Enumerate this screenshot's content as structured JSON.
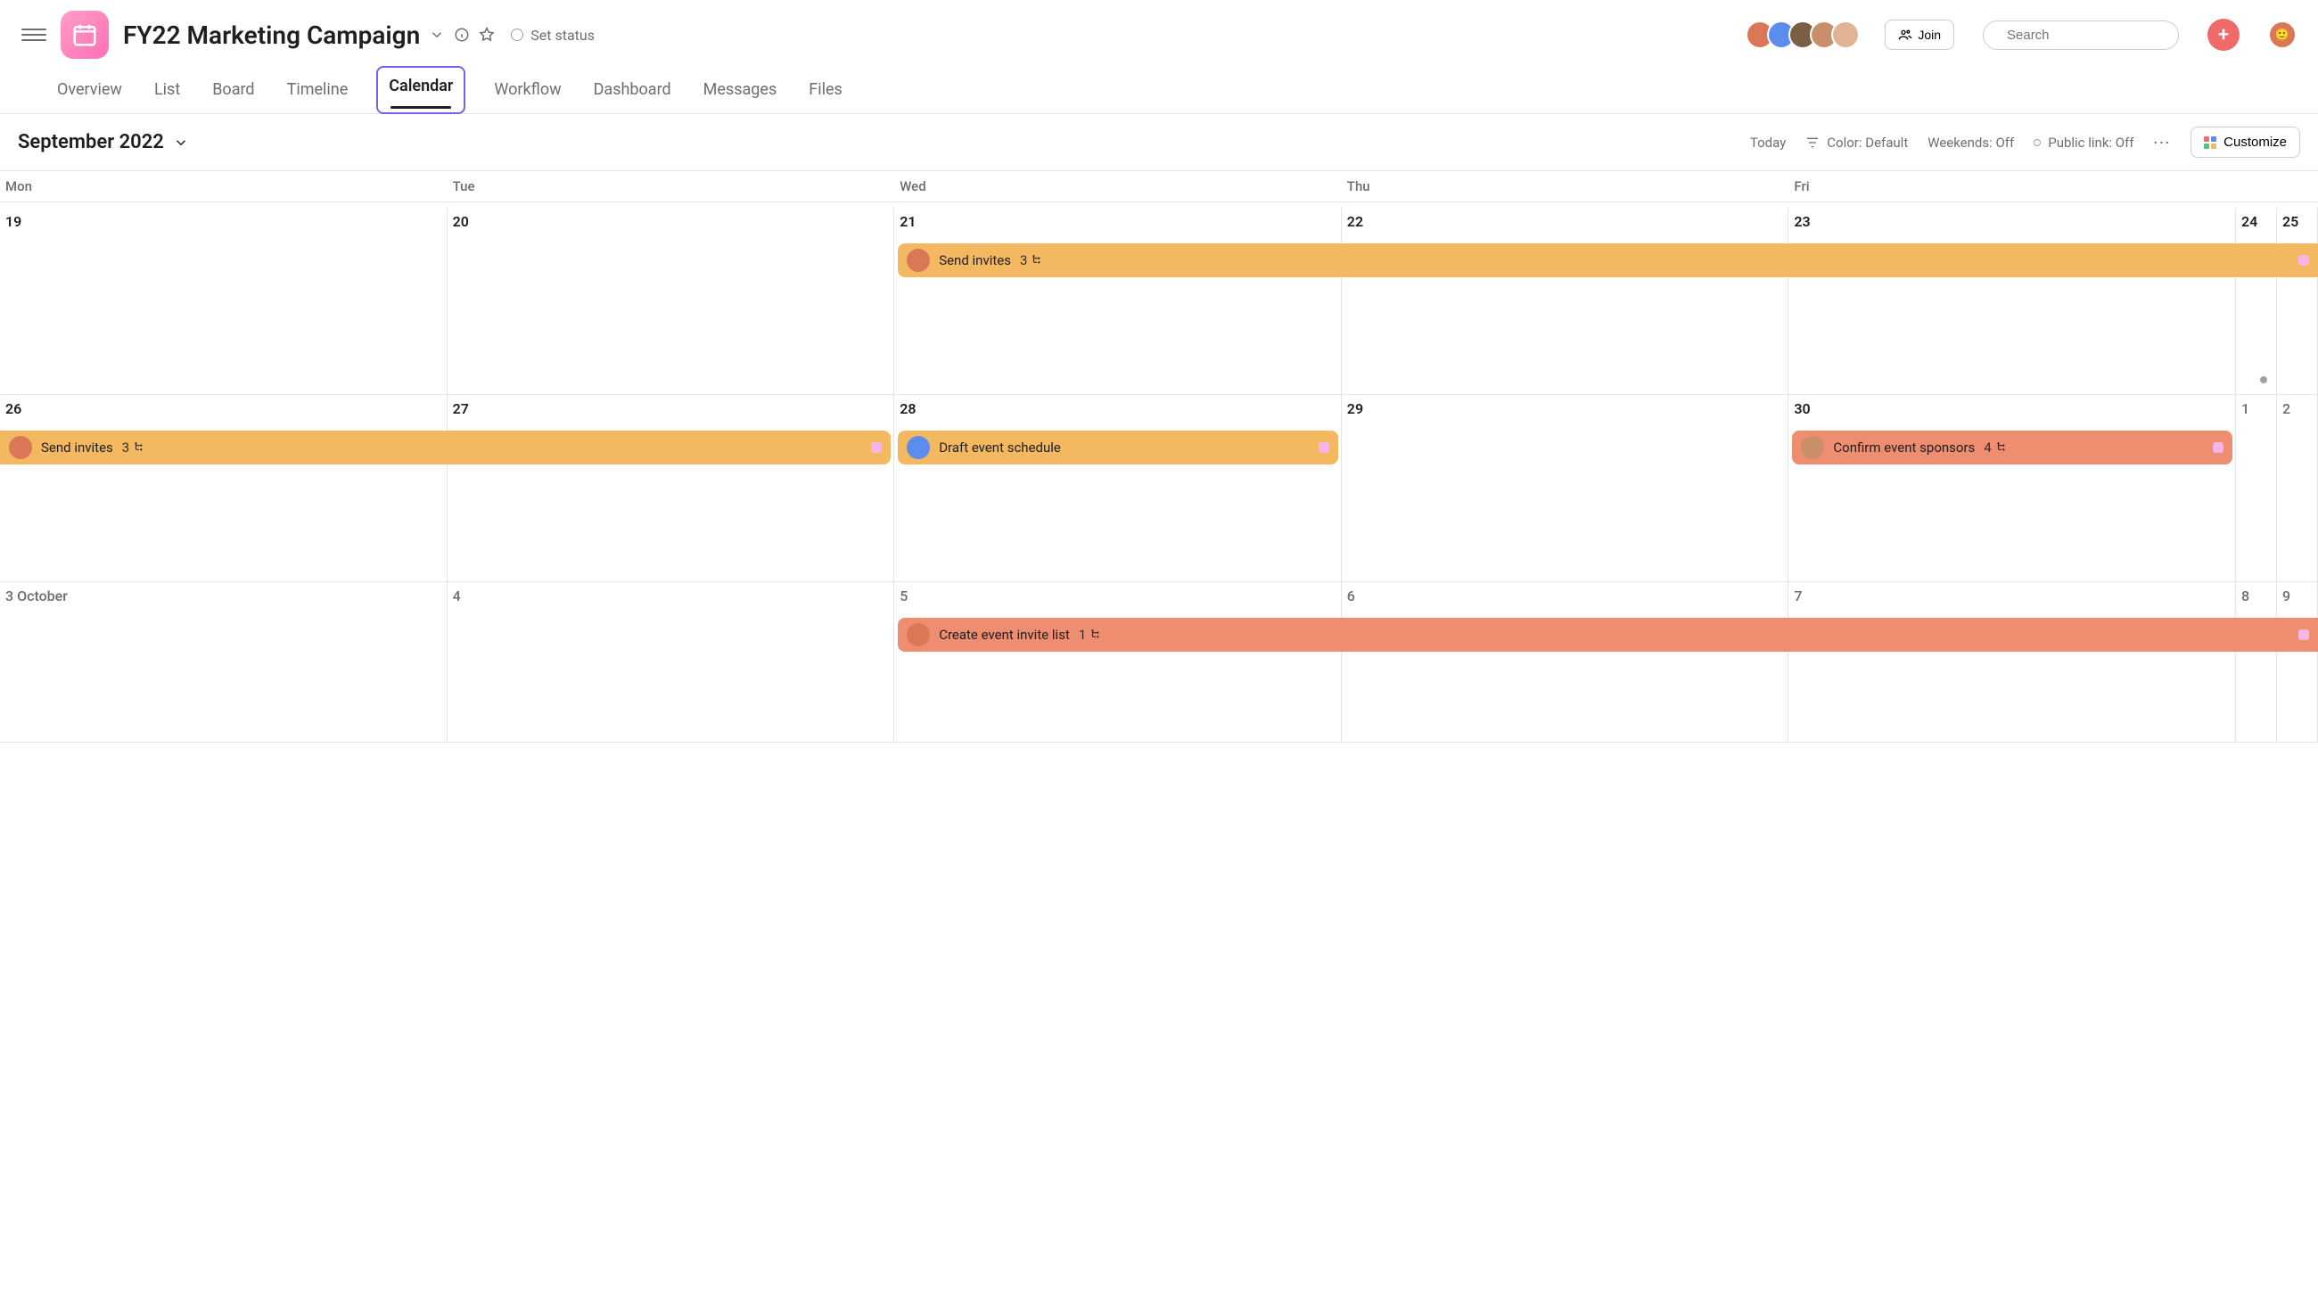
{
  "header": {
    "project_title": "FY22 Marketing Campaign",
    "set_status_label": "Set status",
    "join_label": "Join",
    "search_placeholder": "Search",
    "avatars": [
      "#d97757",
      "#5b8def",
      "#7a5e46",
      "#c98f6b",
      "#e0b394"
    ]
  },
  "tabs": [
    {
      "label": "Overview",
      "active": false
    },
    {
      "label": "List",
      "active": false
    },
    {
      "label": "Board",
      "active": false
    },
    {
      "label": "Timeline",
      "active": false
    },
    {
      "label": "Calendar",
      "active": true
    },
    {
      "label": "Workflow",
      "active": false
    },
    {
      "label": "Dashboard",
      "active": false
    },
    {
      "label": "Messages",
      "active": false
    },
    {
      "label": "Files",
      "active": false
    }
  ],
  "toolbar": {
    "month_label": "September 2022",
    "today_label": "Today",
    "color_label": "Color: Default",
    "weekends_label": "Weekends: Off",
    "public_link_label": "Public link: Off",
    "customize_label": "Customize"
  },
  "dow": [
    "Mon",
    "Tue",
    "Wed",
    "Thu",
    "Fri",
    "",
    ""
  ],
  "weeks": [
    {
      "days": [
        {
          "num": "19",
          "dim": false
        },
        {
          "num": "20",
          "dim": false
        },
        {
          "num": "21",
          "dim": false
        },
        {
          "num": "22",
          "dim": false
        },
        {
          "num": "23",
          "dim": false
        },
        {
          "num": "24",
          "dim": false
        },
        {
          "num": "25",
          "dim": false
        }
      ],
      "overflow_dot_col": 5,
      "tasks": [
        {
          "label": "Send invites",
          "sub": "3",
          "avatar": "#d97757",
          "color": "amber",
          "start": 2,
          "span": 5,
          "end_square": true
        }
      ]
    },
    {
      "days": [
        {
          "num": "26",
          "dim": false
        },
        {
          "num": "27",
          "dim": false
        },
        {
          "num": "28",
          "dim": false
        },
        {
          "num": "29",
          "dim": false
        },
        {
          "num": "30",
          "dim": false
        },
        {
          "num": "1",
          "dim": true
        },
        {
          "num": "2",
          "dim": true
        }
      ],
      "tasks": [
        {
          "label": "Send invites",
          "sub": "3",
          "avatar": "#d97757",
          "color": "amber",
          "start": 0,
          "span": 2,
          "end_square": true,
          "left_flush": true
        },
        {
          "label": "Draft event schedule",
          "sub": "",
          "avatar": "#5b8def",
          "color": "amber",
          "start": 2,
          "span": 1,
          "end_square": true
        },
        {
          "label": "Confirm event sponsors",
          "sub": "4",
          "avatar": "#c98f6b",
          "color": "salmon",
          "start": 4,
          "span": 1,
          "end_square": true
        }
      ]
    },
    {
      "days": [
        {
          "num": "3 October",
          "dim": true
        },
        {
          "num": "4",
          "dim": true
        },
        {
          "num": "5",
          "dim": true
        },
        {
          "num": "6",
          "dim": true
        },
        {
          "num": "7",
          "dim": true
        },
        {
          "num": "8",
          "dim": true
        },
        {
          "num": "9",
          "dim": true
        }
      ],
      "tasks": [
        {
          "label": "Create event invite list",
          "sub": "1",
          "avatar": "#d97757",
          "color": "salmon",
          "start": 2,
          "span": 5,
          "end_square": true
        }
      ]
    }
  ]
}
